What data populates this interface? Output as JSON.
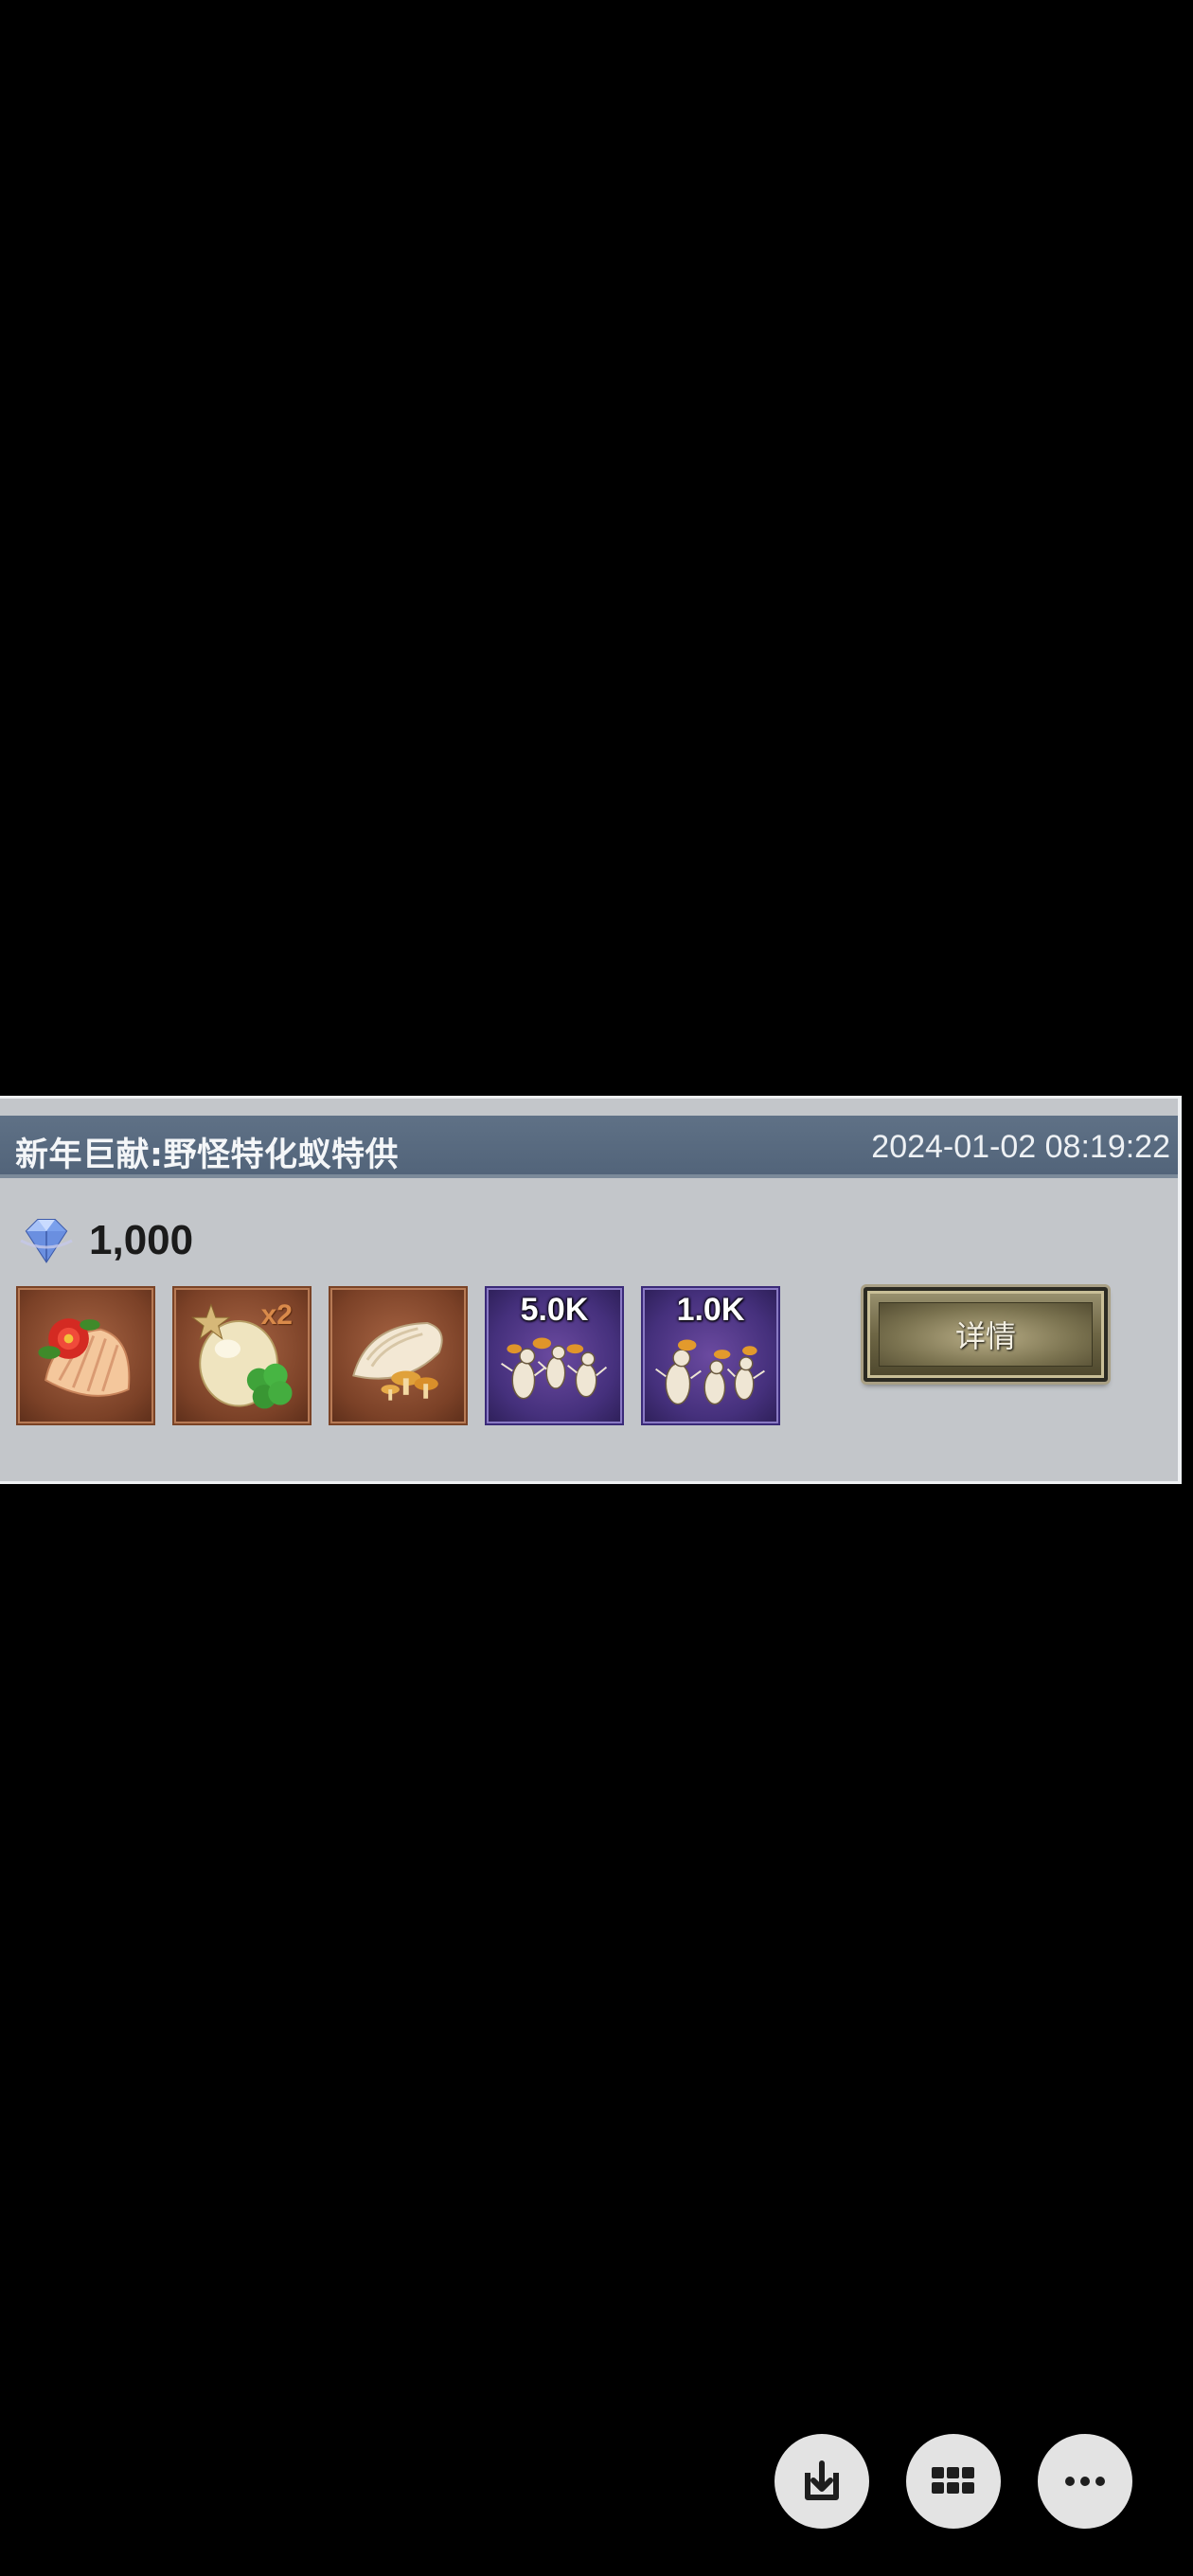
{
  "event": {
    "title": "新年巨献:野怪特化蚁特供",
    "timestamp": "2024-01-02 08:19:22",
    "cost_icon": "diamond-gem-icon",
    "cost_value": "1,000",
    "items": [
      {
        "icon": "shell-flower-icon",
        "quantity": "",
        "multiplier": ""
      },
      {
        "icon": "egg-clover-icon",
        "quantity": "",
        "multiplier": "x2"
      },
      {
        "icon": "larva-mushroom-icon",
        "quantity": "",
        "multiplier": ""
      },
      {
        "icon": "worker-ants-icon",
        "quantity": "5.0K",
        "multiplier": ""
      },
      {
        "icon": "soldier-ants-icon",
        "quantity": "1.0K",
        "multiplier": ""
      }
    ],
    "detail_button_label": "详情"
  },
  "controls": {
    "buttons": [
      {
        "icon": "download-icon"
      },
      {
        "icon": "grid-apps-icon"
      },
      {
        "icon": "more-dots-icon"
      }
    ]
  }
}
